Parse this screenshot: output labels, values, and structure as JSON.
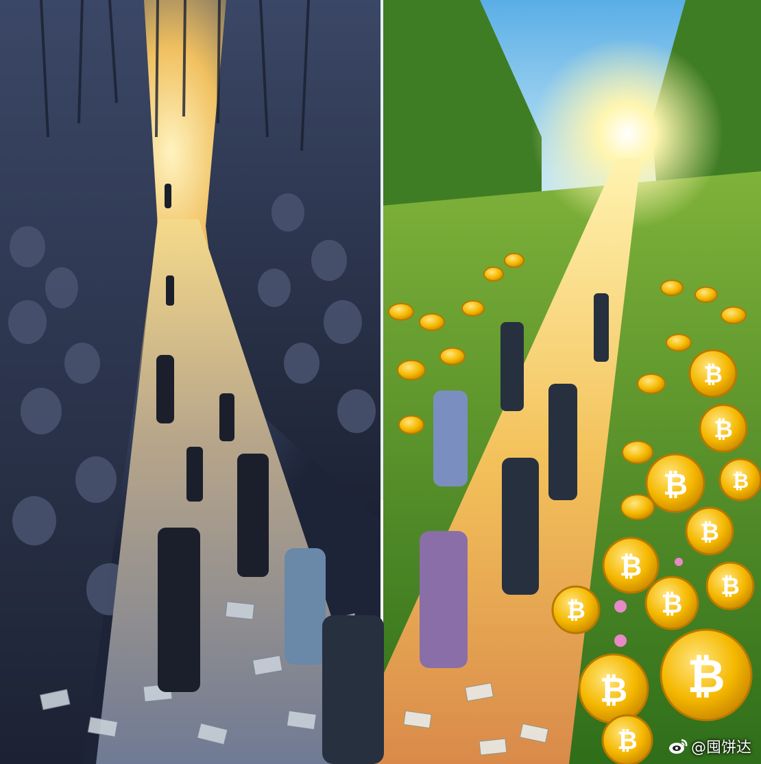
{
  "watermark": {
    "handle": "@囤饼达",
    "icon": "weibo-logo-icon"
  },
  "scene": {
    "left_panel": "dark canyon path lined with ghostly figures, paper money on ground, people walking toward a distant light",
    "right_panel": "sunny green park path with rows of golden bitcoin coins, people walking toward the bright sun",
    "coin_symbol": "₿",
    "colors": {
      "left_wall": "#2a3550",
      "left_light": "#ffd870",
      "right_grass": "#3f8a22",
      "right_sky": "#7fc4f0",
      "coin_gold": "#f5b800",
      "path_sunlit": "#f3c15a"
    }
  }
}
